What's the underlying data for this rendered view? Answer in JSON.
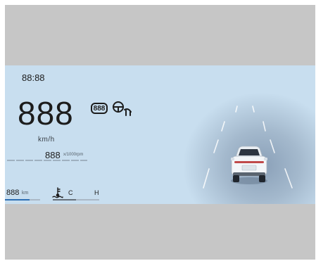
{
  "cluster": {
    "clock": "88:88",
    "speed": {
      "value": "888",
      "unit": "km/h"
    },
    "rpm": {
      "value": "888",
      "unit": "x/1000rpm"
    },
    "indicator_lamp_text": "888",
    "odometer": {
      "value": "888",
      "unit": "km",
      "level": 0.7
    },
    "coolant_temp": {
      "low_label": "C",
      "high_label": "H",
      "level": 0.5
    }
  },
  "icons": [
    "indicator-888-lamp-icon",
    "steering-warning-icon",
    "coolant-temperature-icon",
    "vehicle-rear-icon"
  ],
  "colors": {
    "cluster_background": "#c8deef",
    "frame": "#c6c6c6",
    "odometer_fill": "#2f6fb3",
    "text": "#1c1c1c"
  }
}
